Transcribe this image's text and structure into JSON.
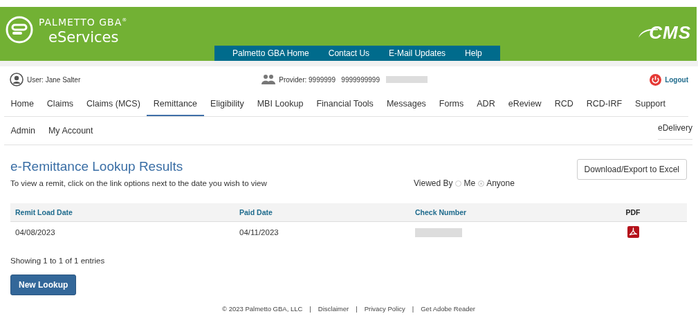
{
  "header": {
    "brand": "PALMETTO GBA",
    "brand_mark": "®",
    "product": "eServices",
    "links": [
      {
        "label": "Palmetto GBA Home"
      },
      {
        "label": "Contact Us"
      },
      {
        "label": "E-Mail Updates"
      },
      {
        "label": "Help"
      }
    ],
    "cms_logo": "CMS"
  },
  "user_bar": {
    "user_label": "User:",
    "user_name": "Jane  Salter",
    "provider_label": "Provider:",
    "provider_id": "9999999",
    "provider_number": "9999999999",
    "logout": "Logout"
  },
  "nav": [
    {
      "label": "Home",
      "selected": false
    },
    {
      "label": "Claims",
      "selected": false
    },
    {
      "label": "Claims (MCS)",
      "selected": false
    },
    {
      "label": "Remittance",
      "selected": true
    },
    {
      "label": "Eligibility",
      "selected": false
    },
    {
      "label": "MBI Lookup",
      "selected": false
    },
    {
      "label": "Financial Tools",
      "selected": false
    },
    {
      "label": "Messages",
      "selected": false
    },
    {
      "label": "Forms",
      "selected": false
    },
    {
      "label": "ADR",
      "selected": false
    },
    {
      "label": "eReview",
      "selected": false
    },
    {
      "label": "RCD",
      "selected": false
    },
    {
      "label": "RCD-IRF",
      "selected": false
    },
    {
      "label": "Support",
      "selected": false
    }
  ],
  "nav_row2": [
    {
      "label": "Admin",
      "selected": false
    },
    {
      "label": "My Account",
      "selected": false
    }
  ],
  "nav_right": "eDelivery",
  "page": {
    "title": "e-Remittance Lookup Results",
    "export_button": "Download/Export to Excel",
    "instructions": "To view a remit, click on the link options next to the date you wish to view",
    "viewed_by": {
      "label": "Viewed By",
      "options": [
        {
          "label": "Me",
          "selected": false
        },
        {
          "label": "Anyone",
          "selected": true
        }
      ]
    }
  },
  "table": {
    "columns": [
      "Remit Load Date",
      "Paid Date",
      "Check Number",
      "PDF"
    ],
    "rows": [
      {
        "remit_load_date": "04/08/2023",
        "paid_date": "04/11/2023"
      }
    ]
  },
  "info": "Showing 1 to 1 of 1 entries",
  "new_lookup": "New Lookup",
  "footer_separator": "|",
  "footer": [
    "© 2023 Palmetto GBA, LLC",
    "Disclaimer",
    "Privacy Policy",
    "Get Adobe Reader"
  ]
}
